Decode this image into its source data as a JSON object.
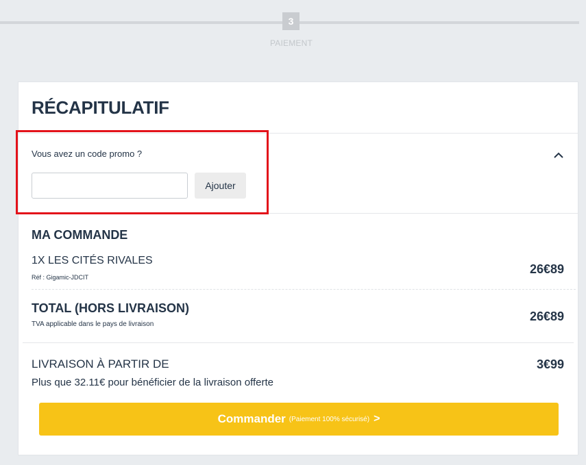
{
  "stepper": {
    "step_number": "3",
    "step_label": "PAIEMENT"
  },
  "summary": {
    "title": "RÉCAPITULATIF",
    "promo": {
      "label": "Vous avez un code promo ?",
      "input_value": "",
      "input_placeholder": "",
      "button_label": "Ajouter",
      "toggle_icon": "chevron-up-icon"
    },
    "order": {
      "section_title": "MA COMMANDE",
      "items": [
        {
          "name": "1X LES CITÉS RIVALES",
          "ref": "Réf : Gigamic-JDCIT",
          "price": "26€89"
        }
      ],
      "total_label": "TOTAL (HORS LIVRAISON)",
      "total_sub": "TVA applicable dans le pays de livraison",
      "total_price": "26€89",
      "shipping_label": "LIVRAISON À PARTIR DE",
      "shipping_price": "3€99",
      "shipping_note": "Plus que 32.11€ pour bénéficier de la livraison offerte"
    },
    "checkout": {
      "label": "Commander",
      "secure_note": "(Paiement 100% sécurisé)",
      "arrow": ">"
    }
  },
  "colors": {
    "accent": "#f7c317",
    "highlight": "#e3121a",
    "text": "#243447"
  }
}
